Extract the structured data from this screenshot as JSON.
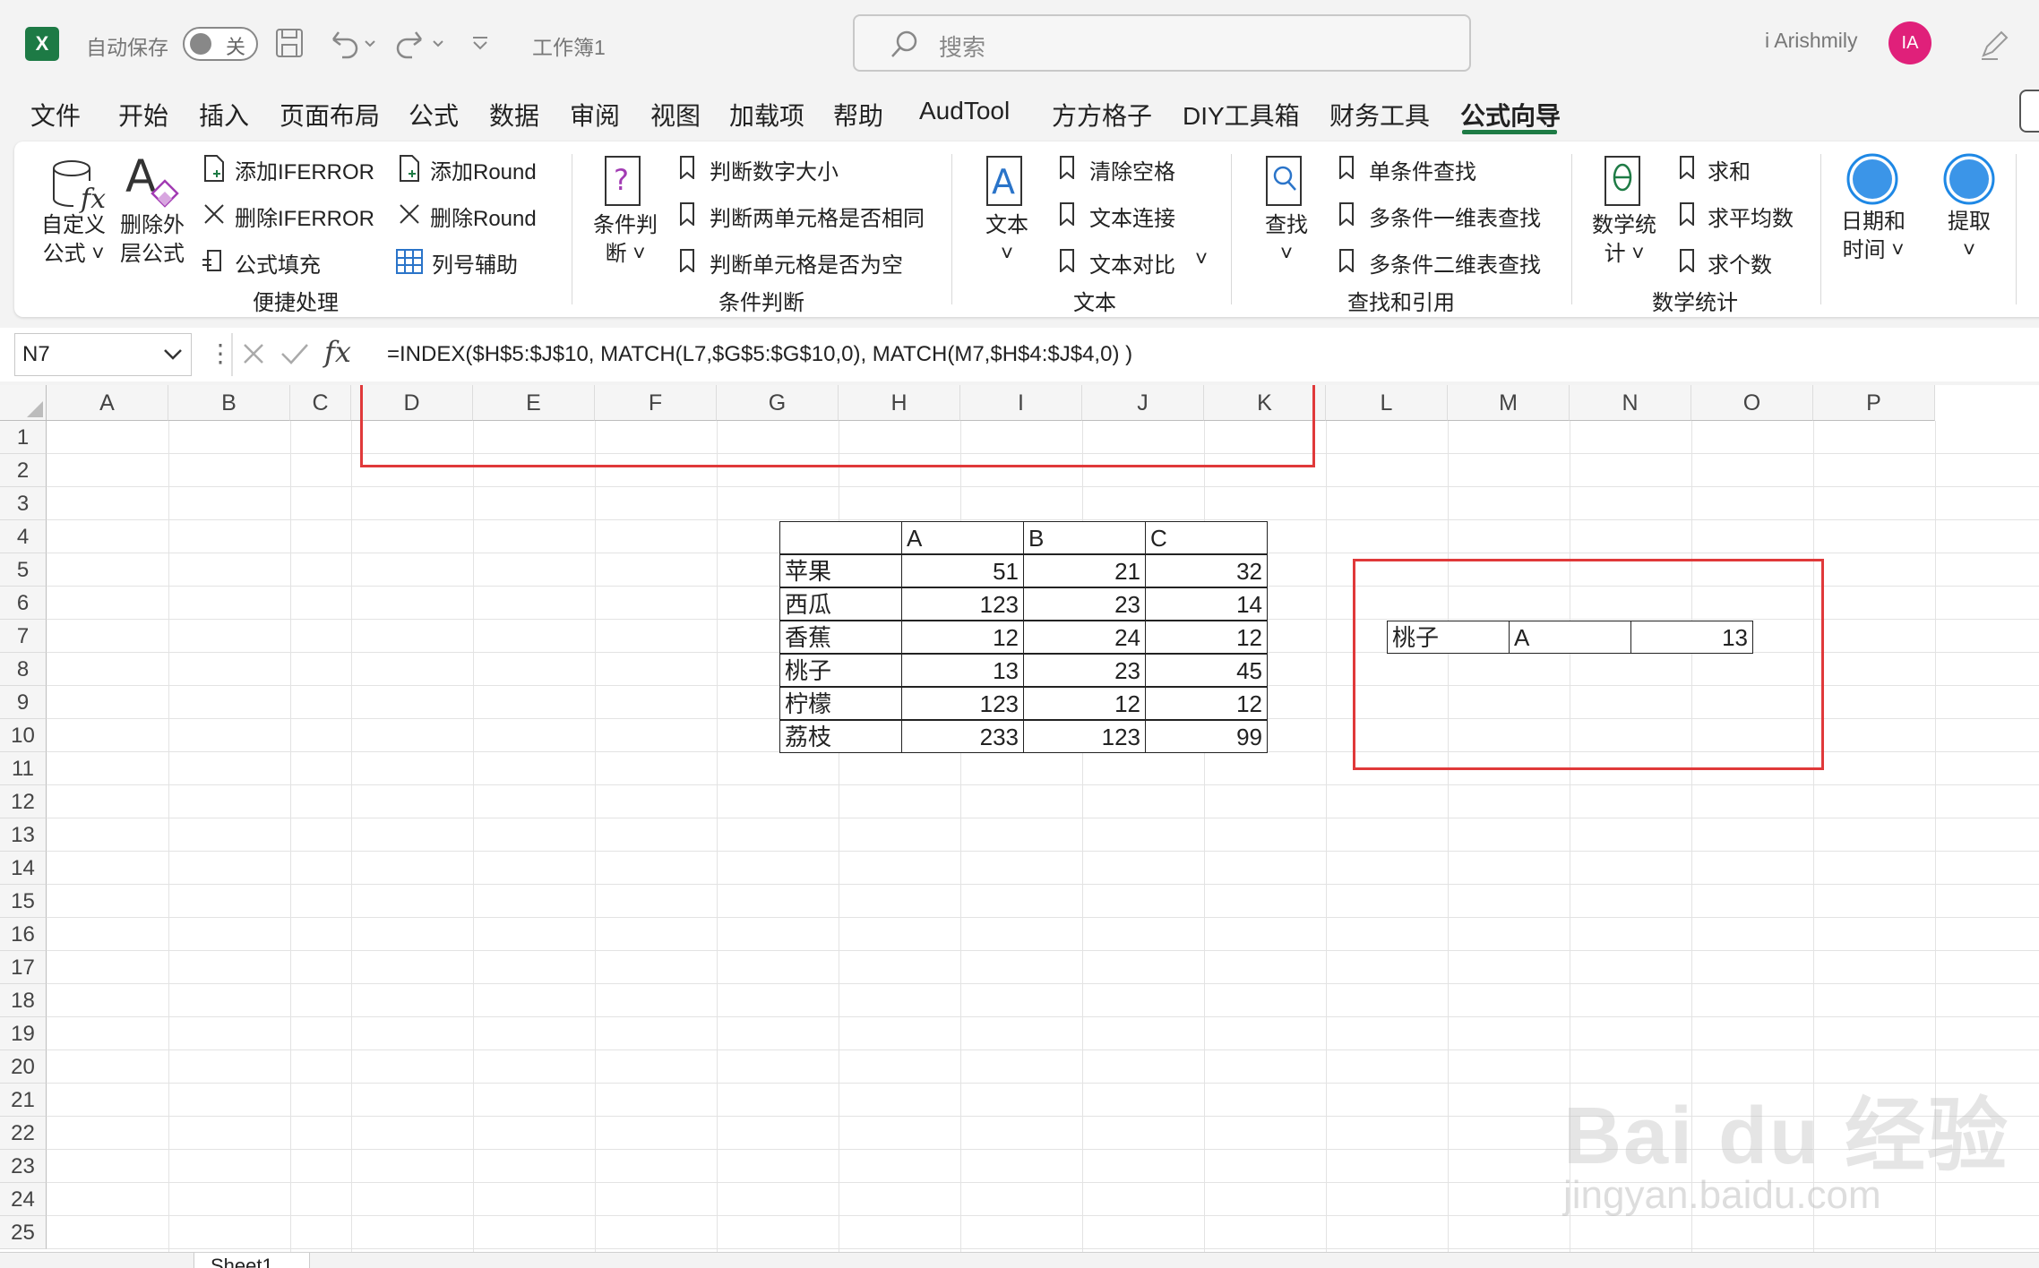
{
  "titlebar": {
    "autosave_label": "自动保存",
    "autosave_state": "关",
    "filename": "工作簿1",
    "search_placeholder": "搜索",
    "user_name": "i Arishmily",
    "avatar_initials": "IA"
  },
  "tabs": [
    "文件",
    "开始",
    "插入",
    "页面布局",
    "公式",
    "数据",
    "审阅",
    "视图",
    "加载项",
    "帮助",
    "AudTool",
    "方方格子",
    "DIY工具箱",
    "财务工具",
    "公式向导"
  ],
  "active_tab": "公式向导",
  "ribbon": {
    "g1": {
      "name": "便捷处理",
      "custom1": "自定义",
      "custom2": "公式",
      "del1": "删除外",
      "del2": "层公式",
      "add_iferror": "添加IFERROR",
      "del_iferror": "删除IFERROR",
      "fill": "公式填充",
      "add_round": "添加Round",
      "del_round": "删除Round",
      "col_helper": "列号辅助"
    },
    "g2": {
      "name": "条件判断",
      "big1": "条件判",
      "big2": "断",
      "item1": "判断数字大小",
      "item2": "判断两单元格是否相同",
      "item3": "判断单元格是否为空"
    },
    "g3": {
      "name": "文本",
      "big": "文本",
      "item1": "清除空格",
      "item2": "文本连接",
      "item3": "文本对比"
    },
    "g4": {
      "name": "查找和引用",
      "big": "查找",
      "item1": "单条件查找",
      "item2": "多条件一维表查找",
      "item3": "多条件二维表查找"
    },
    "g5": {
      "name": "数学统计",
      "big1": "数学统",
      "big2": "计",
      "item1": "求和",
      "item2": "求平均数",
      "item3": "求个数"
    },
    "g6": {
      "dt1": "日期和",
      "dt2": "时间",
      "extract": "提取"
    }
  },
  "formula_bar": {
    "name_box": "N7",
    "formula": "=INDEX($H$5:$J$10, MATCH(L7,$G$5:$G$10,0),  MATCH(M7,$H$4:$J$4,0) )"
  },
  "columns": [
    "A",
    "B",
    "C",
    "D",
    "E",
    "F",
    "G",
    "H",
    "I",
    "J",
    "K",
    "L",
    "M",
    "N",
    "O",
    "P"
  ],
  "rows": [
    "1",
    "2",
    "3",
    "4",
    "5",
    "6",
    "7",
    "8",
    "9",
    "10",
    "11",
    "12",
    "13",
    "14",
    "15",
    "16",
    "17",
    "18",
    "19",
    "20",
    "21",
    "22",
    "23",
    "24",
    "25"
  ],
  "table": {
    "headers": [
      "",
      "A",
      "B",
      "C"
    ],
    "rows": [
      {
        "label": "苹果",
        "a": "51",
        "b": "21",
        "c": "32"
      },
      {
        "label": "西瓜",
        "a": "123",
        "b": "23",
        "c": "14"
      },
      {
        "label": "香蕉",
        "a": "12",
        "b": "24",
        "c": "12"
      },
      {
        "label": "桃子",
        "a": "13",
        "b": "23",
        "c": "45"
      },
      {
        "label": "柠檬",
        "a": "123",
        "b": "12",
        "c": "12"
      },
      {
        "label": "荔枝",
        "a": "233",
        "b": "123",
        "c": "99"
      }
    ]
  },
  "lookup": {
    "l7": "桃子",
    "m7": "A",
    "n7": "13"
  },
  "sheet_tab": "Sheet1",
  "watermark": {
    "line1": "Bai du 经验",
    "line2": "jingyan.baidu.com"
  },
  "colors": {
    "excel_green": "#1d7a45",
    "highlight_red": "#e0393a",
    "avatar": "#e0207a",
    "accent_blue": "#1e88e5"
  }
}
